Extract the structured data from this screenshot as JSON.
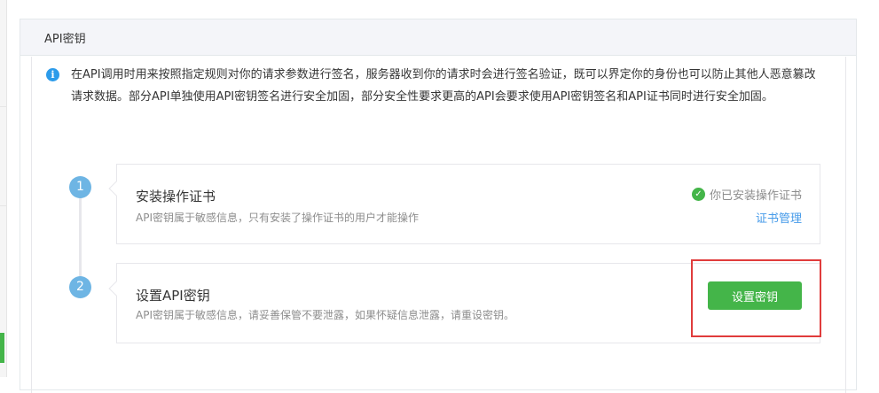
{
  "panel": {
    "title": "API密钥"
  },
  "notice": {
    "icon": "info-icon",
    "text": "在API调用时用来按照指定规则对你的请求参数进行签名，服务器收到你的请求时会进行签名验证，既可以界定你的身份也可以防止其他人恶意篡改请求数据。部分API单独使用API密钥签名进行安全加固，部分安全性要求更高的API会要求使用API密钥签名和API证书同时进行安全加固。"
  },
  "steps": [
    {
      "number": "1",
      "title": "安装操作证书",
      "description": "API密钥属于敏感信息，只有安装了操作证书的用户才能操作",
      "status_text": "你已安装操作证书",
      "status_icon": "check-circle-icon",
      "link_label": "证书管理"
    },
    {
      "number": "2",
      "title": "设置API密钥",
      "description": "API密钥属于敏感信息，请妥善保管不要泄露，如果怀疑信息泄露，请重设密钥。",
      "button_label": "设置密钥"
    }
  ],
  "colors": {
    "accent_green": "#44b549",
    "link_blue": "#459ae9",
    "step_blue": "#6eb5e4",
    "highlight_red": "#e03c3c"
  }
}
